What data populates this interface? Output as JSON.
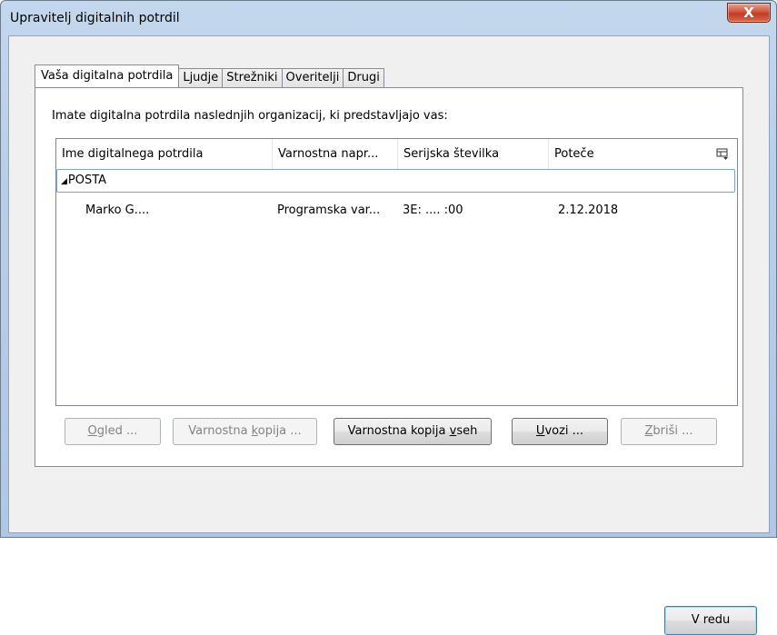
{
  "window": {
    "title": "Upravitelj digitalnih potrdil",
    "close_label": "X"
  },
  "tabs": [
    {
      "label": "Vaša digitalna potrdila",
      "active": true
    },
    {
      "label": "Ljudje",
      "active": false
    },
    {
      "label": "Strežniki",
      "active": false
    },
    {
      "label": "Overitelji",
      "active": false
    },
    {
      "label": "Drugi",
      "active": false
    }
  ],
  "panel": {
    "intro": "Imate digitalna potrdila naslednjih organizacij, ki predstavljajo vas:"
  },
  "table": {
    "columns": [
      "Ime digitalnega potrdila",
      "Varnostna napr...",
      "Serijska številka",
      "Poteče"
    ],
    "column_picker_icon": "column-picker-icon",
    "groups": [
      {
        "name": "POSTA",
        "expanded": true,
        "rows": [
          {
            "name": "Marko G....",
            "device": "Programska var...",
            "serial": "3E:  ....  :00",
            "expires": "2.12.2018"
          }
        ]
      }
    ]
  },
  "buttons": {
    "view": {
      "pre": "",
      "key": "O",
      "post": "gled ..."
    },
    "backup": {
      "pre": "Varnostna ",
      "key": "k",
      "post": "opija ..."
    },
    "backup_all": {
      "pre": "Varnostna kopija ",
      "key": "v",
      "post": "seh"
    },
    "import": {
      "pre": "",
      "key": "U",
      "post": "vozi ..."
    },
    "delete": {
      "pre": "",
      "key": "Z",
      "post": "briši ..."
    },
    "ok": "V redu"
  }
}
